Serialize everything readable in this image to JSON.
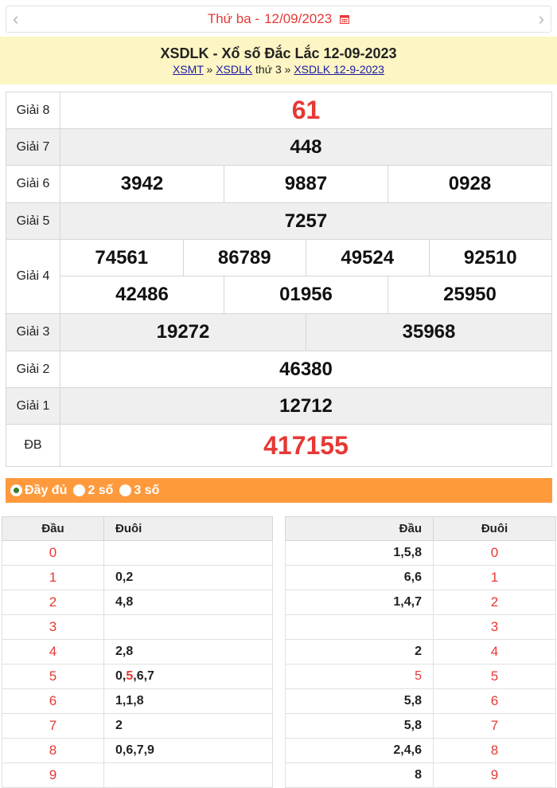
{
  "date_nav": {
    "prev_icon": "chevron-left-icon",
    "next_icon": "chevron-right-icon",
    "weekday": "Thứ ba -",
    "date": "12/09/2023",
    "calendar_icon": "calendar-icon"
  },
  "header": {
    "title": "XSDLK - Xổ số Đắc Lắc 12-09-2023",
    "crumb1": "XSMT",
    "sep1": "»",
    "crumb2": "XSDLK",
    "crumb2_suffix": "thứ 3",
    "sep2": "»",
    "crumb3": "XSDLK 12-9-2023"
  },
  "results": {
    "g8_label": "Giải 8",
    "g8": "61",
    "g7_label": "Giải 7",
    "g7": "448",
    "g6_label": "Giải 6",
    "g6": [
      "3942",
      "9887",
      "0928"
    ],
    "g5_label": "Giải 5",
    "g5": "7257",
    "g4_label": "Giải 4",
    "g4_row1": [
      "74561",
      "86789",
      "49524",
      "92510"
    ],
    "g4_row2": [
      "42486",
      "01956",
      "25950"
    ],
    "g3_label": "Giải 3",
    "g3": [
      "19272",
      "35968"
    ],
    "g2_label": "Giải 2",
    "g2": "46380",
    "g1_label": "Giải 1",
    "g1": "12712",
    "db_label": "ĐB",
    "db": "417155"
  },
  "options": {
    "full": "Đầy đủ",
    "two": "2 số",
    "three": "3 số",
    "selected": "full"
  },
  "dau_table": {
    "col_dau": "Đầu",
    "col_duoi": "Đuôi",
    "rows": [
      {
        "dau": "0",
        "duoi": ""
      },
      {
        "dau": "1",
        "duoi": "0,2"
      },
      {
        "dau": "2",
        "duoi": "4,8"
      },
      {
        "dau": "3",
        "duoi": ""
      },
      {
        "dau": "4",
        "duoi": "2,8"
      },
      {
        "dau": "5",
        "duoi_pre": "0,",
        "duoi_hl": "5",
        "duoi_post": ",6,7"
      },
      {
        "dau": "6",
        "duoi": "1,1,8"
      },
      {
        "dau": "7",
        "duoi": "2"
      },
      {
        "dau": "8",
        "duoi": "0,6,7,9"
      },
      {
        "dau": "9",
        "duoi": ""
      }
    ]
  },
  "duoi_table": {
    "col_dau": "Đầu",
    "col_duoi": "Đuôi",
    "rows": [
      {
        "dau": "1,5,8",
        "duoi": "0"
      },
      {
        "dau": "6,6",
        "duoi": "1"
      },
      {
        "dau": "1,4,7",
        "duoi": "2"
      },
      {
        "dau": "",
        "duoi": "3"
      },
      {
        "dau": "2",
        "duoi": "4"
      },
      {
        "dau": "5",
        "duoi": "5",
        "dau_red": true
      },
      {
        "dau": "5,8",
        "duoi": "6"
      },
      {
        "dau": "5,8",
        "duoi": "7"
      },
      {
        "dau": "2,4,6",
        "duoi": "8"
      },
      {
        "dau": "8",
        "duoi": "9"
      }
    ]
  }
}
